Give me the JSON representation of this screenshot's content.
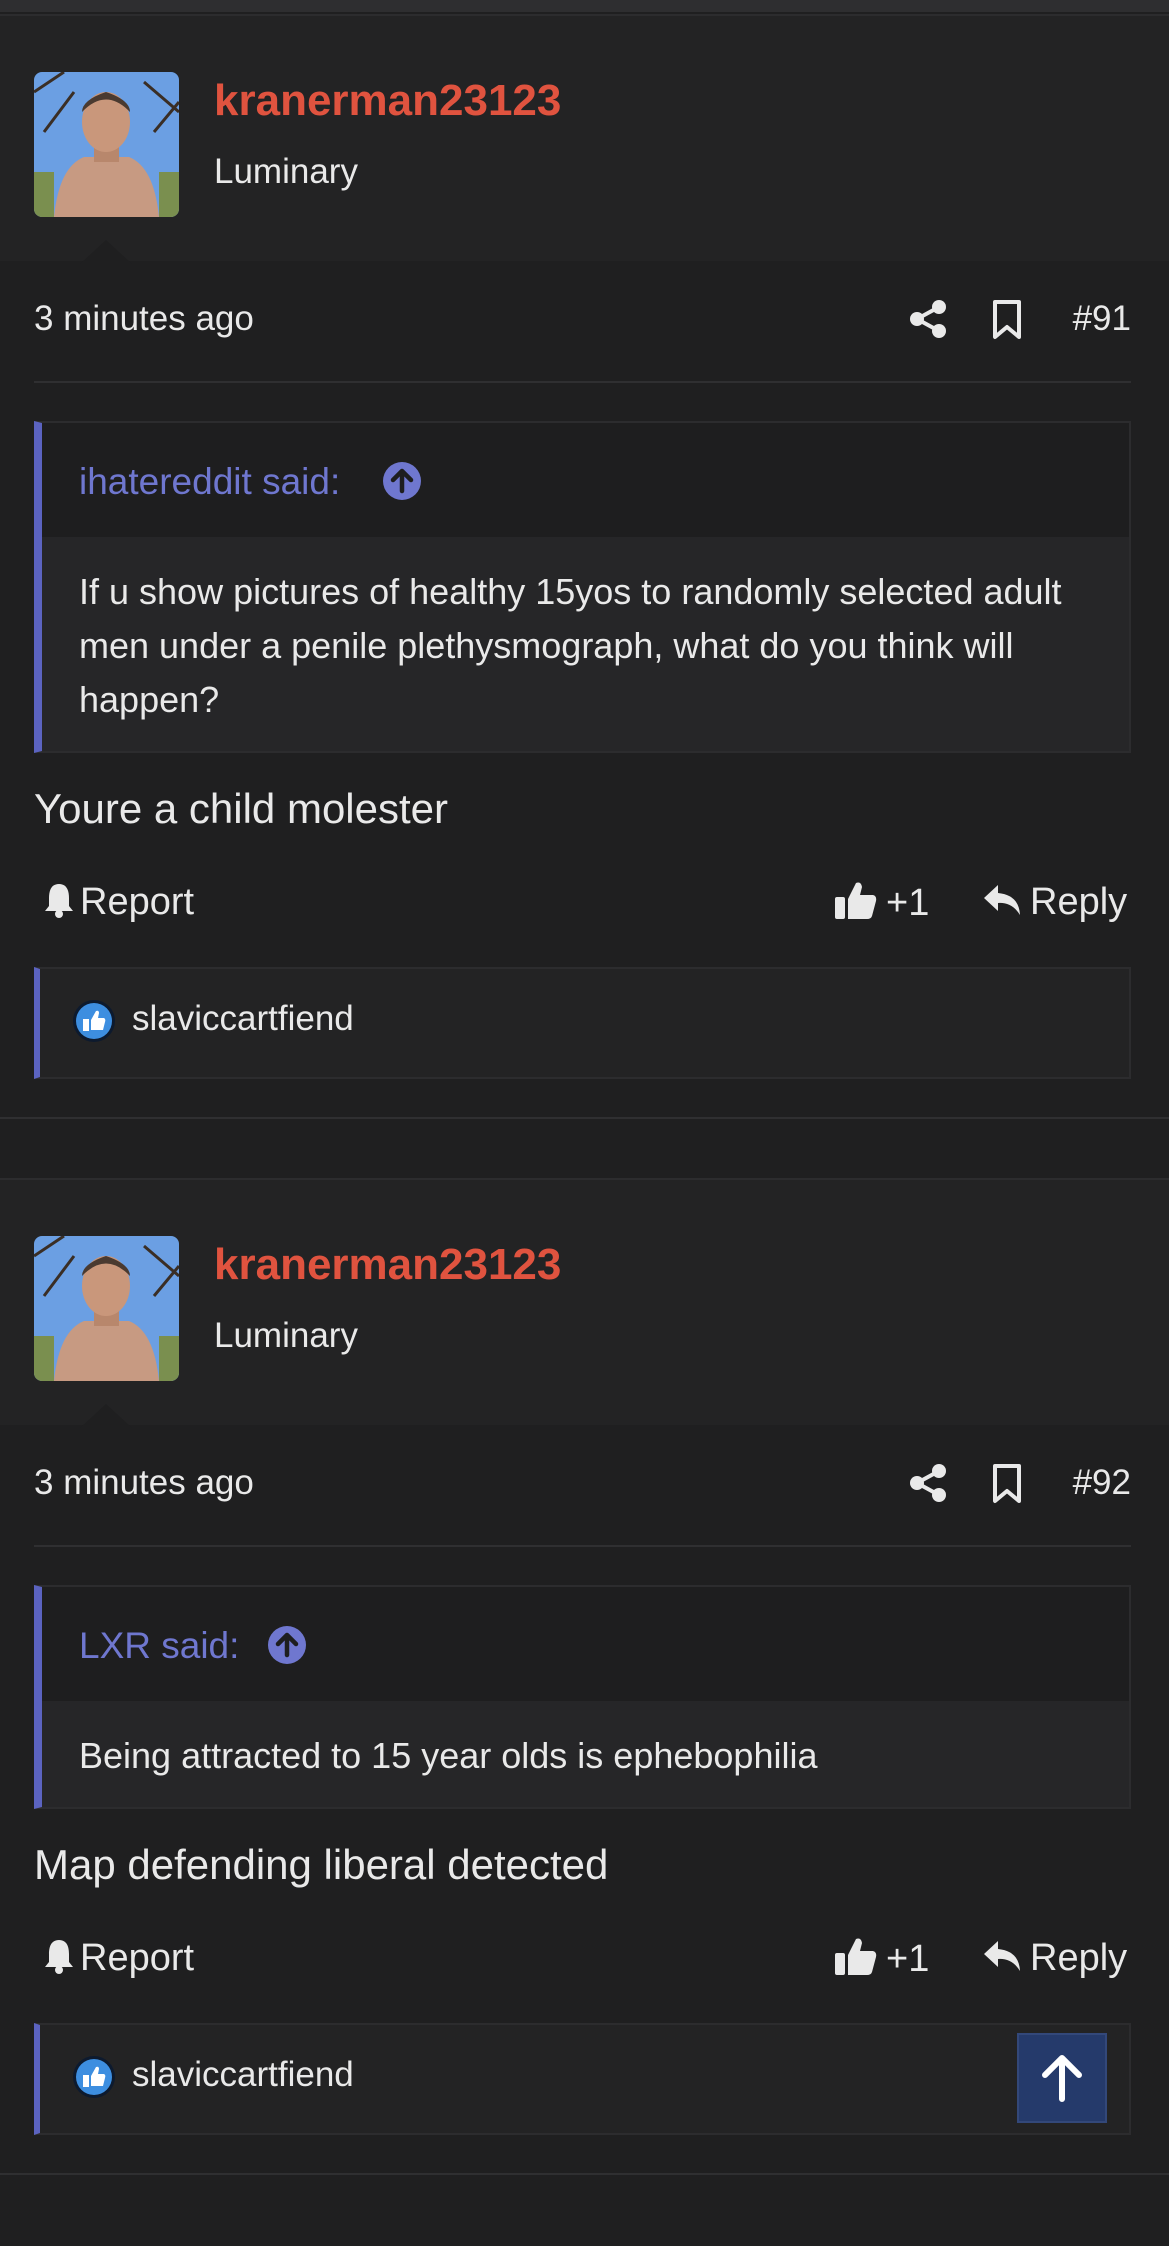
{
  "posts": [
    {
      "username": "kranerman23123",
      "user_title": "Luminary",
      "time": "3 minutes ago",
      "post_number": "#91",
      "quote": {
        "author": "ihatereddit said:",
        "text": "If u show pictures of healthy 15yos to randomly selected adult men under a penile plethysmograph, what do you think will happen?"
      },
      "message": "Youre a child molester",
      "report_label": "Report",
      "like_count": "+1",
      "reply_label": "Reply",
      "reacted_user": "slaviccartfiend"
    },
    {
      "username": "kranerman23123",
      "user_title": "Luminary",
      "time": "3 minutes ago",
      "post_number": "#92",
      "quote": {
        "author": "LXR said:",
        "text": "Being attracted to 15 year olds is ephebophilia"
      },
      "message": "Map defending liberal detected",
      "report_label": "Report",
      "like_count": "+1",
      "reply_label": "Reply",
      "reacted_user": "slaviccartfiend"
    }
  ],
  "icons": {
    "share": "share-icon",
    "bookmark": "bookmark-icon",
    "report": "bell-icon",
    "like": "thumbs-up-icon",
    "reply": "reply-arrow-icon",
    "quote_jump": "arrow-up-circle-icon",
    "scroll_top": "arrow-up-icon"
  },
  "colors": {
    "username": "#e0533f",
    "accent": "#5b63c0",
    "quote_author": "#6f77cf",
    "background": "#1f1f20"
  }
}
